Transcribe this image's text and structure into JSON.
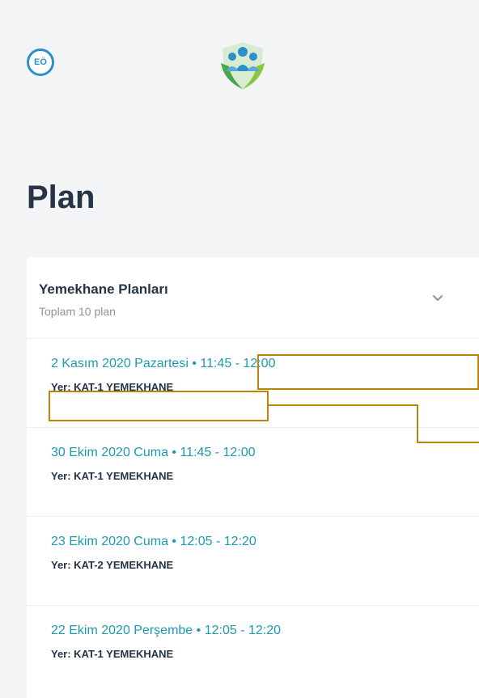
{
  "header": {
    "avatar_initials": "EÖ",
    "logo_icon": "people-shield-hands-logo"
  },
  "page": {
    "title": "Plan"
  },
  "section": {
    "title": "Yemekhane Planları",
    "subtitle": "Toplam 10 plan",
    "toggle_icon": "chevron-down-icon"
  },
  "plans": [
    {
      "when": "2 Kasım 2020 Pazartesi • 11:45 - 12:00",
      "where": "Yer: KAT-1 YEMEKHANE"
    },
    {
      "when": "30 Ekim 2020 Cuma • 11:45 - 12:00",
      "where": "Yer: KAT-1 YEMEKHANE"
    },
    {
      "when": "23 Ekim 2020 Cuma • 12:05 - 12:20",
      "where": "Yer: KAT-2 YEMEKHANE"
    },
    {
      "when": "22 Ekim 2020 Perşembe • 12:05 - 12:20",
      "where": "Yer: KAT-1 YEMEKHANE"
    }
  ],
  "colors": {
    "accent": "#1e9ab0",
    "text_dark": "#263445",
    "muted": "#8b949c",
    "annotation": "#b8860b",
    "avatar": "#2c8fc8"
  }
}
